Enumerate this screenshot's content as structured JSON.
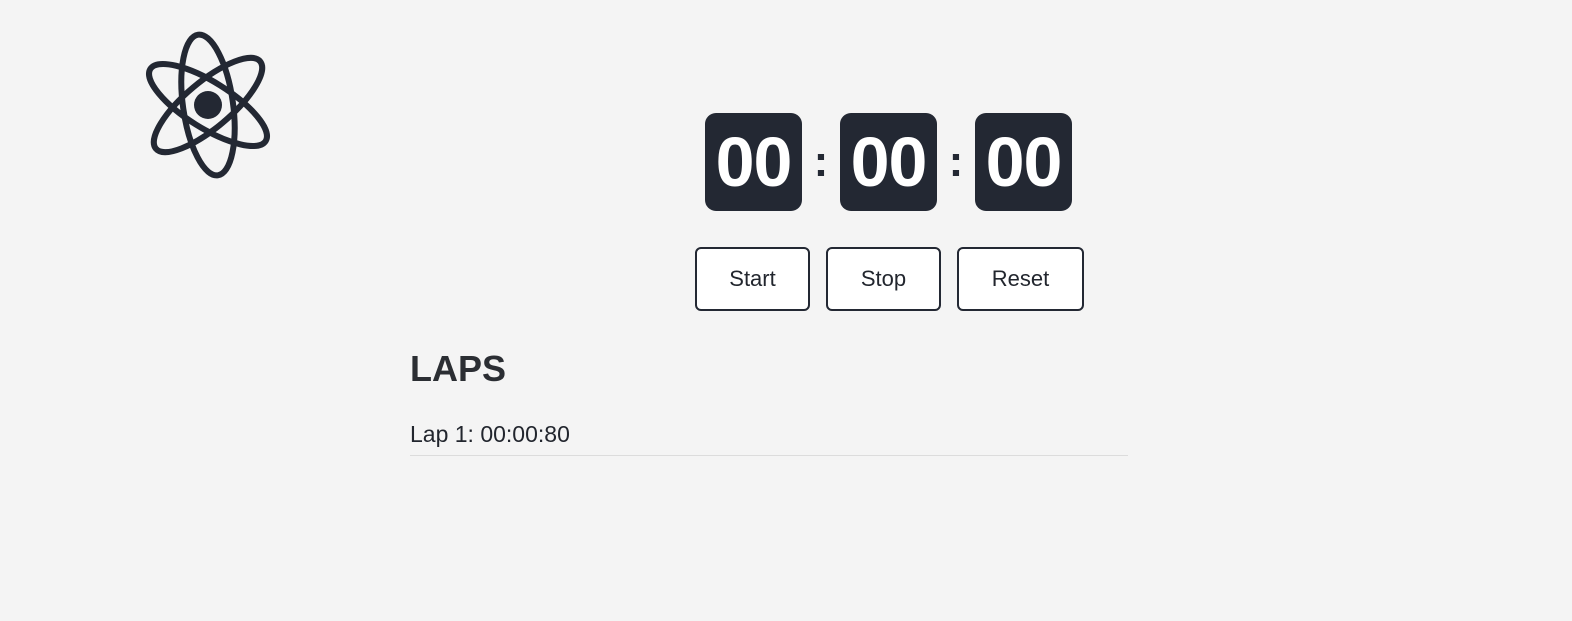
{
  "app": {
    "logo_icon": "atom-icon",
    "accent_color": "#232833"
  },
  "timer": {
    "hours": "00",
    "minutes": "00",
    "seconds": "00",
    "separator": ":"
  },
  "controls": {
    "start_label": "Start",
    "stop_label": "Stop",
    "reset_label": "Reset"
  },
  "laps": {
    "title": "LAPS",
    "items": [
      {
        "label": "Lap 1: 00:00:80"
      }
    ]
  }
}
